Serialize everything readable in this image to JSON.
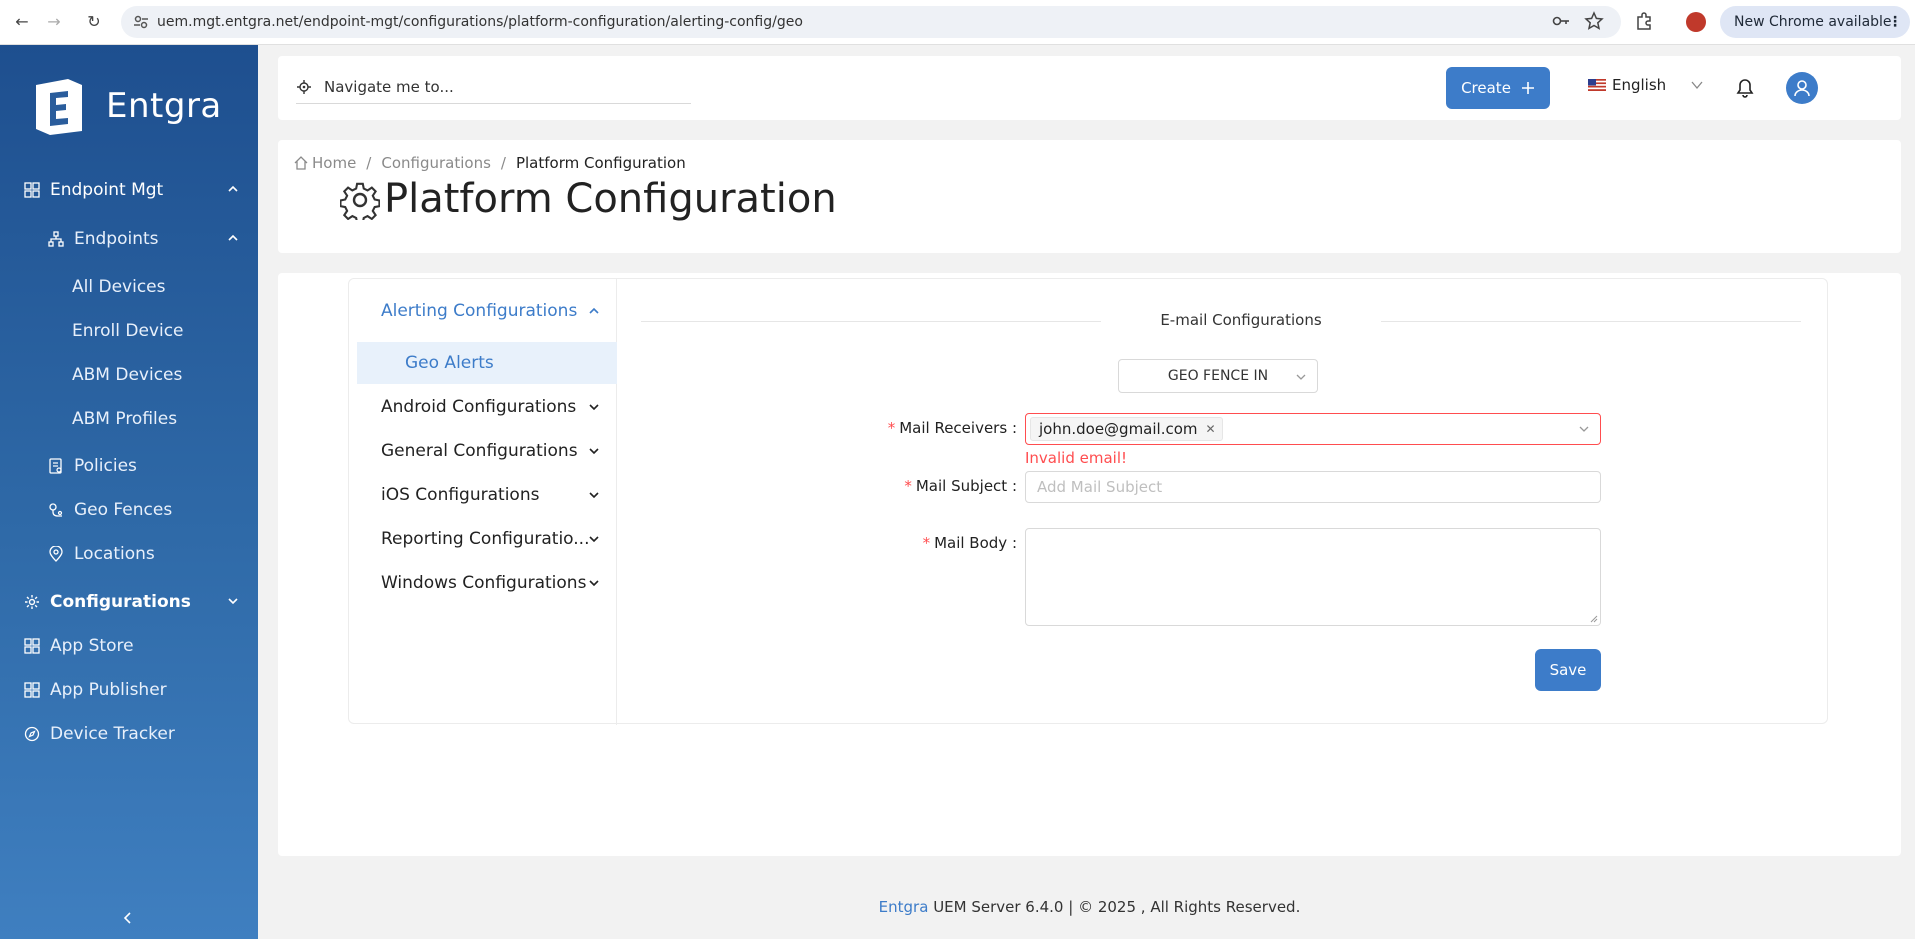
{
  "browser": {
    "url": "uem.mgt.entgra.net/endpoint-mgt/configurations/platform-configuration/alerting-config/geo",
    "update_label": "New Chrome available"
  },
  "sidebar": {
    "brand": "Entgra",
    "items": [
      {
        "label": "Endpoint Mgt"
      },
      {
        "label": "Endpoints"
      },
      {
        "label": "All Devices"
      },
      {
        "label": "Enroll Device"
      },
      {
        "label": "ABM Devices"
      },
      {
        "label": "ABM Profiles"
      },
      {
        "label": "Policies"
      },
      {
        "label": "Geo Fences"
      },
      {
        "label": "Locations"
      },
      {
        "label": "Configurations"
      },
      {
        "label": "App Store"
      },
      {
        "label": "App Publisher"
      },
      {
        "label": "Device Tracker"
      }
    ]
  },
  "topbar": {
    "search_placeholder": "Navigate me to...",
    "create_label": "Create",
    "language": "English"
  },
  "breadcrumb": {
    "home": "Home",
    "configurations": "Configurations",
    "current": "Platform Configuration"
  },
  "page_title": "Platform Configuration",
  "config_menu": {
    "items": [
      {
        "label": "Alerting Configurations"
      },
      {
        "label": "Geo Alerts"
      },
      {
        "label": "Android Configurations"
      },
      {
        "label": "General Configurations"
      },
      {
        "label": "iOS Configurations"
      },
      {
        "label": "Reporting Configuratio..."
      },
      {
        "label": "Windows Configurations"
      }
    ]
  },
  "form": {
    "section_title": "E-mail Configurations",
    "geo_select_value": "GEO FENCE IN",
    "mail_receivers_label": "Mail Receivers",
    "mail_receiver_tag": "john.doe@gmail.com",
    "mail_receivers_error": "Invalid email!",
    "mail_subject_label": "Mail Subject",
    "mail_subject_placeholder": "Add Mail Subject",
    "mail_body_label": "Mail Body",
    "save_label": "Save"
  },
  "footer": {
    "brand": "Entgra",
    "text": "UEM Server 6.4.0 | © 2025 , All Rights Reserved."
  },
  "colors": {
    "accent": "#3d7cc9",
    "sidebar_top": "#1e4f8f",
    "error": "#ff4d4f"
  }
}
